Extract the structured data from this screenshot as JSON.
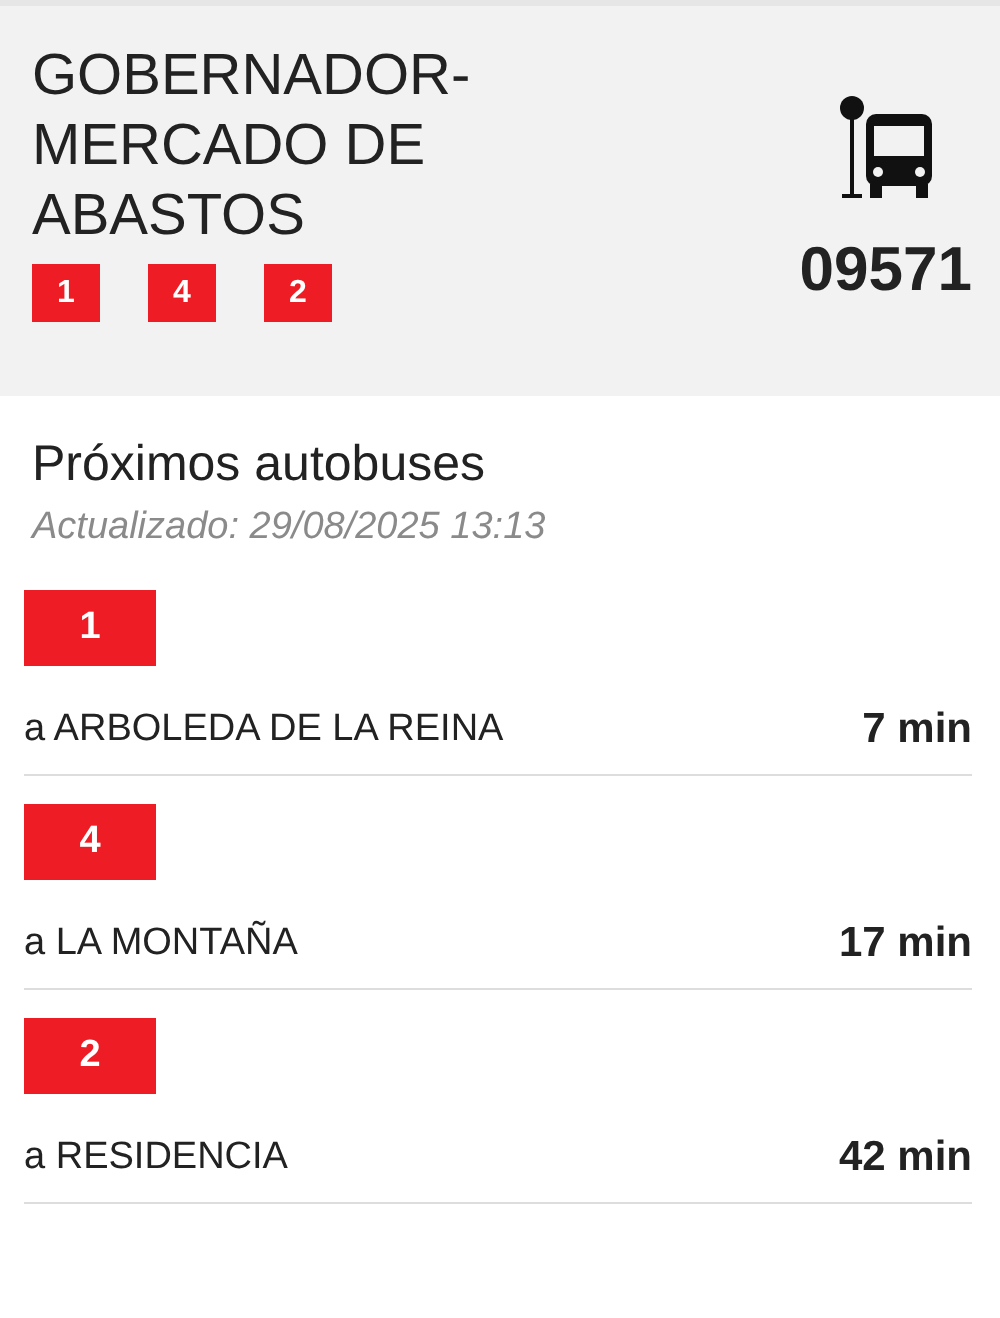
{
  "stop": {
    "name": "GOBERNADOR-MERCADO DE ABASTOS",
    "lines": [
      "1",
      "4",
      "2"
    ],
    "code": "09571"
  },
  "section": {
    "title": "Próximos autobuses",
    "updated": "Actualizado: 29/08/2025 13:13"
  },
  "arrivals": [
    {
      "line": "1",
      "destination": "a ARBOLEDA DE LA REINA",
      "time": "7 min"
    },
    {
      "line": "4",
      "destination": "a LA MONTAÑA",
      "time": "17 min"
    },
    {
      "line": "2",
      "destination": "a RESIDENCIA",
      "time": "42 min"
    }
  ]
}
